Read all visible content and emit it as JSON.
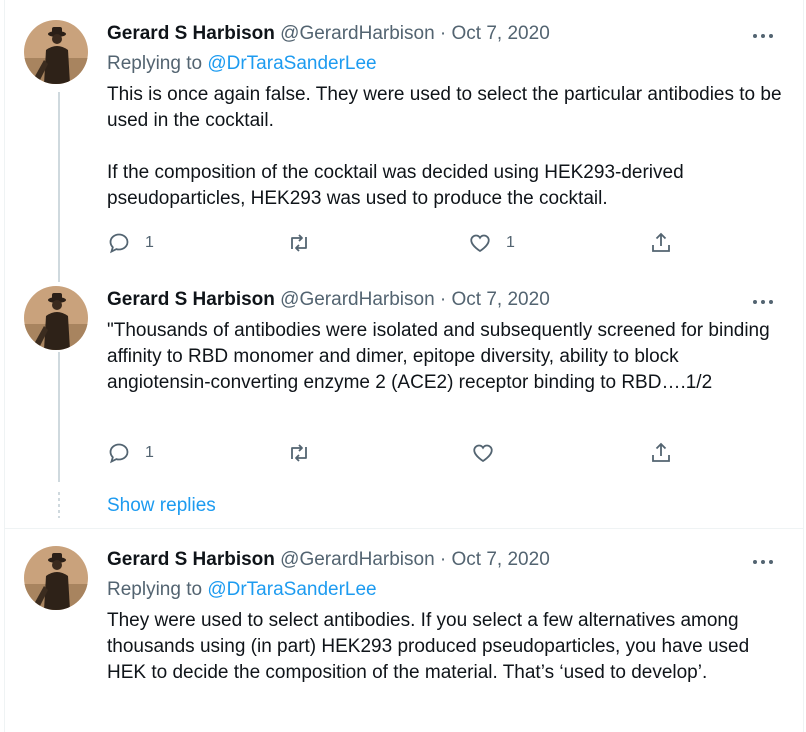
{
  "tweets": [
    {
      "name": "Gerard S Harbison",
      "handle": "@GerardHarbison",
      "separator": "·",
      "date": "Oct 7, 2020",
      "replying_prefix": "Replying to",
      "replying_to": "@DrTaraSanderLee",
      "paragraphs": [
        "This is once again false. They were used to select the particular antibodies to be used in the cocktail.",
        "If the composition of the cocktail was decided using HEK293-derived pseudoparticles, HEK293 was used to produce the cocktail."
      ],
      "replies": "1",
      "retweets": "",
      "likes": "1"
    },
    {
      "name": "Gerard S Harbison",
      "handle": "@GerardHarbison",
      "separator": "·",
      "date": "Oct 7, 2020",
      "paragraphs": [
        "\"Thousands of antibodies were isolated and subsequently screened for binding affinity to RBD monomer and dimer, epitope diversity, ability to block angiotensin-converting enzyme 2 (ACE2) receptor binding to RBD….1/2"
      ],
      "replies": "1",
      "retweets": "",
      "likes": ""
    },
    {
      "name": "Gerard S Harbison",
      "handle": "@GerardHarbison",
      "separator": "·",
      "date": "Oct 7, 2020",
      "replying_prefix": "Replying to",
      "replying_to": "@DrTaraSanderLee",
      "paragraphs": [
        "They were used to select antibodies. If you select a few alternatives among thousands using (in part) HEK293 produced pseudoparticles, you have used HEK to decide the composition of the material. That’s ‘used to develop’."
      ]
    }
  ],
  "show_replies": "Show replies",
  "icons": {
    "more": "more-horizontal-icon",
    "reply": "reply-icon",
    "retweet": "retweet-icon",
    "like": "heart-icon",
    "share": "share-icon"
  },
  "colors": {
    "link": "#1d9bf0",
    "secondary": "#536471",
    "text": "#0f1419",
    "thread_line": "#cfd9de"
  }
}
